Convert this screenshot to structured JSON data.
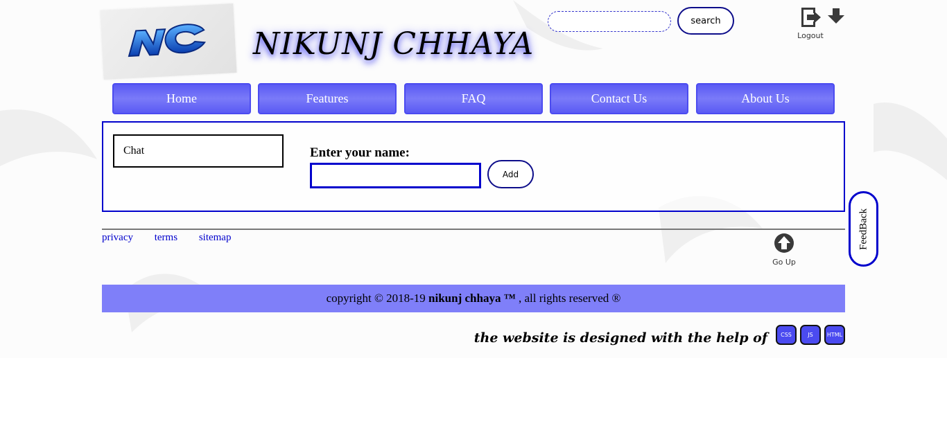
{
  "header": {
    "site_title": "NIKUNJ CHHAYA",
    "logo_text": "NC",
    "search": {
      "placeholder": "",
      "value": "",
      "button_label": "search"
    },
    "logout_label": "Logout"
  },
  "nav": {
    "items": [
      {
        "label": "Home"
      },
      {
        "label": "Features"
      },
      {
        "label": "FAQ"
      },
      {
        "label": "Contact Us"
      },
      {
        "label": "About Us"
      }
    ]
  },
  "main": {
    "chat_tab_label": "Chat",
    "name_label": "Enter your name:",
    "name_value": "",
    "add_button_label": "Add"
  },
  "feedback_label": "FeedBack",
  "footer": {
    "links": [
      {
        "label": "privacy"
      },
      {
        "label": "terms"
      },
      {
        "label": "sitemap"
      }
    ],
    "go_up_label": "Go Up",
    "copyright_prefix": "copyright © 2018-19 ",
    "copyright_brand": "nikunj chhaya ™",
    "copyright_suffix": " , all rights reserved ®",
    "designed_text": "the website is designed with the help of",
    "tech_badges": [
      "CSS",
      "JS",
      "HTML"
    ]
  },
  "colors": {
    "accent": "#0000cc",
    "nav_bg": "#5a5af4",
    "copyright_bg": "#7f7ff9"
  },
  "icons": {
    "logout": "logout-arrow-icon",
    "download": "download-arrow-icon",
    "go_up": "up-arrow-circle-icon"
  }
}
